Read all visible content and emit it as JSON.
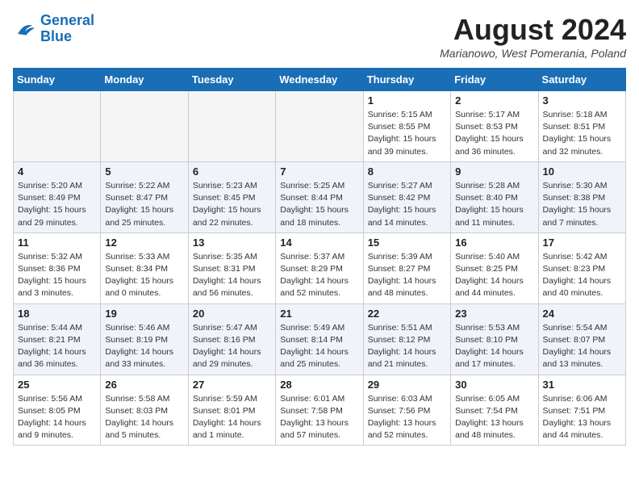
{
  "header": {
    "logo_line1": "General",
    "logo_line2": "Blue",
    "month_year": "August 2024",
    "location": "Marianowo, West Pomerania, Poland"
  },
  "weekdays": [
    "Sunday",
    "Monday",
    "Tuesday",
    "Wednesday",
    "Thursday",
    "Friday",
    "Saturday"
  ],
  "weeks": [
    [
      {
        "day": "",
        "info": ""
      },
      {
        "day": "",
        "info": ""
      },
      {
        "day": "",
        "info": ""
      },
      {
        "day": "",
        "info": ""
      },
      {
        "day": "1",
        "info": "Sunrise: 5:15 AM\nSunset: 8:55 PM\nDaylight: 15 hours\nand 39 minutes."
      },
      {
        "day": "2",
        "info": "Sunrise: 5:17 AM\nSunset: 8:53 PM\nDaylight: 15 hours\nand 36 minutes."
      },
      {
        "day": "3",
        "info": "Sunrise: 5:18 AM\nSunset: 8:51 PM\nDaylight: 15 hours\nand 32 minutes."
      }
    ],
    [
      {
        "day": "4",
        "info": "Sunrise: 5:20 AM\nSunset: 8:49 PM\nDaylight: 15 hours\nand 29 minutes."
      },
      {
        "day": "5",
        "info": "Sunrise: 5:22 AM\nSunset: 8:47 PM\nDaylight: 15 hours\nand 25 minutes."
      },
      {
        "day": "6",
        "info": "Sunrise: 5:23 AM\nSunset: 8:45 PM\nDaylight: 15 hours\nand 22 minutes."
      },
      {
        "day": "7",
        "info": "Sunrise: 5:25 AM\nSunset: 8:44 PM\nDaylight: 15 hours\nand 18 minutes."
      },
      {
        "day": "8",
        "info": "Sunrise: 5:27 AM\nSunset: 8:42 PM\nDaylight: 15 hours\nand 14 minutes."
      },
      {
        "day": "9",
        "info": "Sunrise: 5:28 AM\nSunset: 8:40 PM\nDaylight: 15 hours\nand 11 minutes."
      },
      {
        "day": "10",
        "info": "Sunrise: 5:30 AM\nSunset: 8:38 PM\nDaylight: 15 hours\nand 7 minutes."
      }
    ],
    [
      {
        "day": "11",
        "info": "Sunrise: 5:32 AM\nSunset: 8:36 PM\nDaylight: 15 hours\nand 3 minutes."
      },
      {
        "day": "12",
        "info": "Sunrise: 5:33 AM\nSunset: 8:34 PM\nDaylight: 15 hours\nand 0 minutes."
      },
      {
        "day": "13",
        "info": "Sunrise: 5:35 AM\nSunset: 8:31 PM\nDaylight: 14 hours\nand 56 minutes."
      },
      {
        "day": "14",
        "info": "Sunrise: 5:37 AM\nSunset: 8:29 PM\nDaylight: 14 hours\nand 52 minutes."
      },
      {
        "day": "15",
        "info": "Sunrise: 5:39 AM\nSunset: 8:27 PM\nDaylight: 14 hours\nand 48 minutes."
      },
      {
        "day": "16",
        "info": "Sunrise: 5:40 AM\nSunset: 8:25 PM\nDaylight: 14 hours\nand 44 minutes."
      },
      {
        "day": "17",
        "info": "Sunrise: 5:42 AM\nSunset: 8:23 PM\nDaylight: 14 hours\nand 40 minutes."
      }
    ],
    [
      {
        "day": "18",
        "info": "Sunrise: 5:44 AM\nSunset: 8:21 PM\nDaylight: 14 hours\nand 36 minutes."
      },
      {
        "day": "19",
        "info": "Sunrise: 5:46 AM\nSunset: 8:19 PM\nDaylight: 14 hours\nand 33 minutes."
      },
      {
        "day": "20",
        "info": "Sunrise: 5:47 AM\nSunset: 8:16 PM\nDaylight: 14 hours\nand 29 minutes."
      },
      {
        "day": "21",
        "info": "Sunrise: 5:49 AM\nSunset: 8:14 PM\nDaylight: 14 hours\nand 25 minutes."
      },
      {
        "day": "22",
        "info": "Sunrise: 5:51 AM\nSunset: 8:12 PM\nDaylight: 14 hours\nand 21 minutes."
      },
      {
        "day": "23",
        "info": "Sunrise: 5:53 AM\nSunset: 8:10 PM\nDaylight: 14 hours\nand 17 minutes."
      },
      {
        "day": "24",
        "info": "Sunrise: 5:54 AM\nSunset: 8:07 PM\nDaylight: 14 hours\nand 13 minutes."
      }
    ],
    [
      {
        "day": "25",
        "info": "Sunrise: 5:56 AM\nSunset: 8:05 PM\nDaylight: 14 hours\nand 9 minutes."
      },
      {
        "day": "26",
        "info": "Sunrise: 5:58 AM\nSunset: 8:03 PM\nDaylight: 14 hours\nand 5 minutes."
      },
      {
        "day": "27",
        "info": "Sunrise: 5:59 AM\nSunset: 8:01 PM\nDaylight: 14 hours\nand 1 minute."
      },
      {
        "day": "28",
        "info": "Sunrise: 6:01 AM\nSunset: 7:58 PM\nDaylight: 13 hours\nand 57 minutes."
      },
      {
        "day": "29",
        "info": "Sunrise: 6:03 AM\nSunset: 7:56 PM\nDaylight: 13 hours\nand 52 minutes."
      },
      {
        "day": "30",
        "info": "Sunrise: 6:05 AM\nSunset: 7:54 PM\nDaylight: 13 hours\nand 48 minutes."
      },
      {
        "day": "31",
        "info": "Sunrise: 6:06 AM\nSunset: 7:51 PM\nDaylight: 13 hours\nand 44 minutes."
      }
    ]
  ]
}
